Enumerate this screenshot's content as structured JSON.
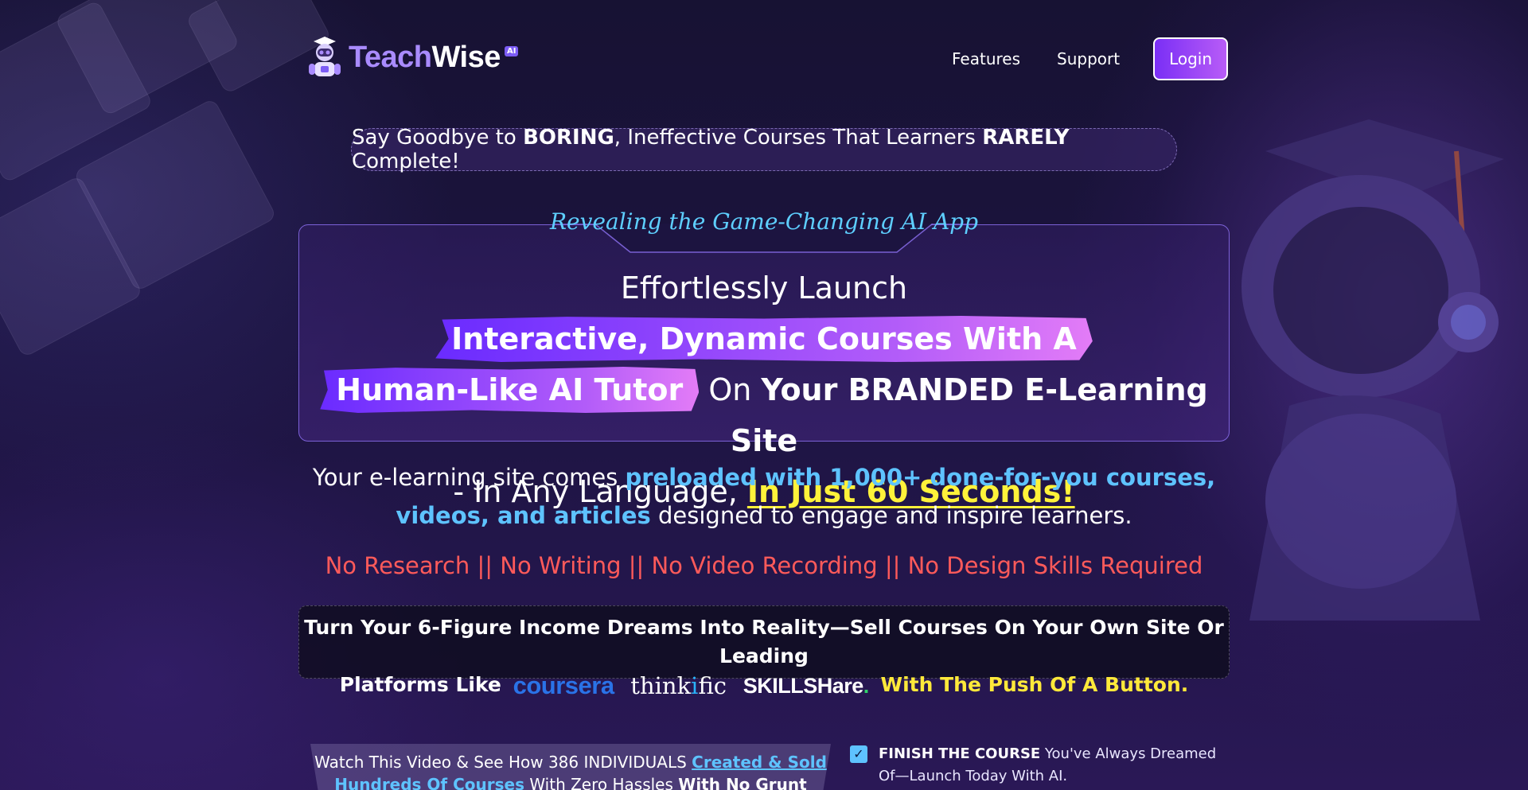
{
  "brand": {
    "name_part1": "Teach",
    "name_part2": "Wise",
    "badge": "AI"
  },
  "nav": {
    "features": "Features",
    "support": "Support",
    "login": "Login"
  },
  "tagline": {
    "part1": "Say Goodbye to ",
    "bold1": "BORING",
    "part2": ", Ineffective Courses That Learners ",
    "bold2": "RARELY",
    "part3": " Complete!"
  },
  "hero": {
    "subtitle": "Revealing the Game-Changing AI App",
    "line1_plain": "Effortlessly Launch ",
    "line1_highlight": "Interactive, Dynamic Courses With A",
    "line2_highlight": "Human-Like AI Tutor",
    "line2_plain": " On ",
    "line2_bold": "Your BRANDED E-Learning Site",
    "line3_plain": "- In Any Language, ",
    "line3_yellow": "In Just 60 Seconds!"
  },
  "description": {
    "part1": "Your e-learning site comes ",
    "blue": "preloaded with 1,000+ done-for-you courses, videos, and articles",
    "part2": " designed to engage and inspire learners."
  },
  "no_requirements": "No Research || No Writing || No Video Recording || No Design Skills Required",
  "income": {
    "line1": "Turn Your 6-Figure Income Dreams Into Reality—Sell Courses On Your Own Site Or Leading",
    "line2_start": "Platforms Like",
    "line2_end": "With The Push Of A Button.",
    "platforms": {
      "coursera": "coursera",
      "thinkific_a": "think",
      "thinkific_i": "i",
      "thinkific_b": "fic",
      "skillshare": "SKILLSHare",
      "skillshare_dot": "."
    }
  },
  "video": {
    "part1": "Watch This Video & See How 386 INDIVIDUALS ",
    "link": "Created & Sold Hundreds Of Courses",
    "part2": " With Zero Hassles ",
    "bold": "With No Grunt Work"
  },
  "checklist": [
    {
      "bold": "FINISH THE COURSE",
      "text": " You've Always Dreamed Of—Launch Today With AI.",
      "checked": true
    }
  ],
  "colors": {
    "accent_purple": "#7a2ff5",
    "link_blue": "#5ec3ff",
    "warning_red": "#ff5a5a",
    "highlight_yellow": "#fff23a"
  }
}
